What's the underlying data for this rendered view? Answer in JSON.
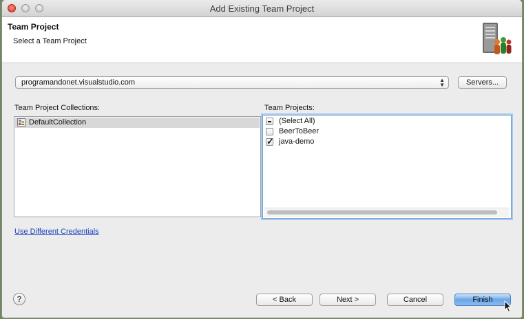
{
  "window": {
    "title": "Add Existing Team Project"
  },
  "header": {
    "title": "Team Project",
    "subtitle": "Select a Team Project",
    "icon": "server-users-icon"
  },
  "server": {
    "selected": "programandonet.visualstudio.com",
    "servers_button": "Servers..."
  },
  "collections": {
    "label": "Team Project Collections:",
    "items": [
      {
        "label": "DefaultCollection",
        "selected": true
      }
    ]
  },
  "projects": {
    "label": "Team Projects:",
    "items": [
      {
        "label": "(Select All)",
        "state": "mixed"
      },
      {
        "label": "BeerToBeer",
        "state": "unchecked"
      },
      {
        "label": "java-demo",
        "state": "checked"
      }
    ]
  },
  "credentials_link": "Use Different Credentials",
  "footer": {
    "help": "?",
    "back": "< Back",
    "next": "Next >",
    "cancel": "Cancel",
    "finish": "Finish"
  },
  "colors": {
    "accent": "#6aa6e6",
    "link": "#1a3fbf"
  }
}
